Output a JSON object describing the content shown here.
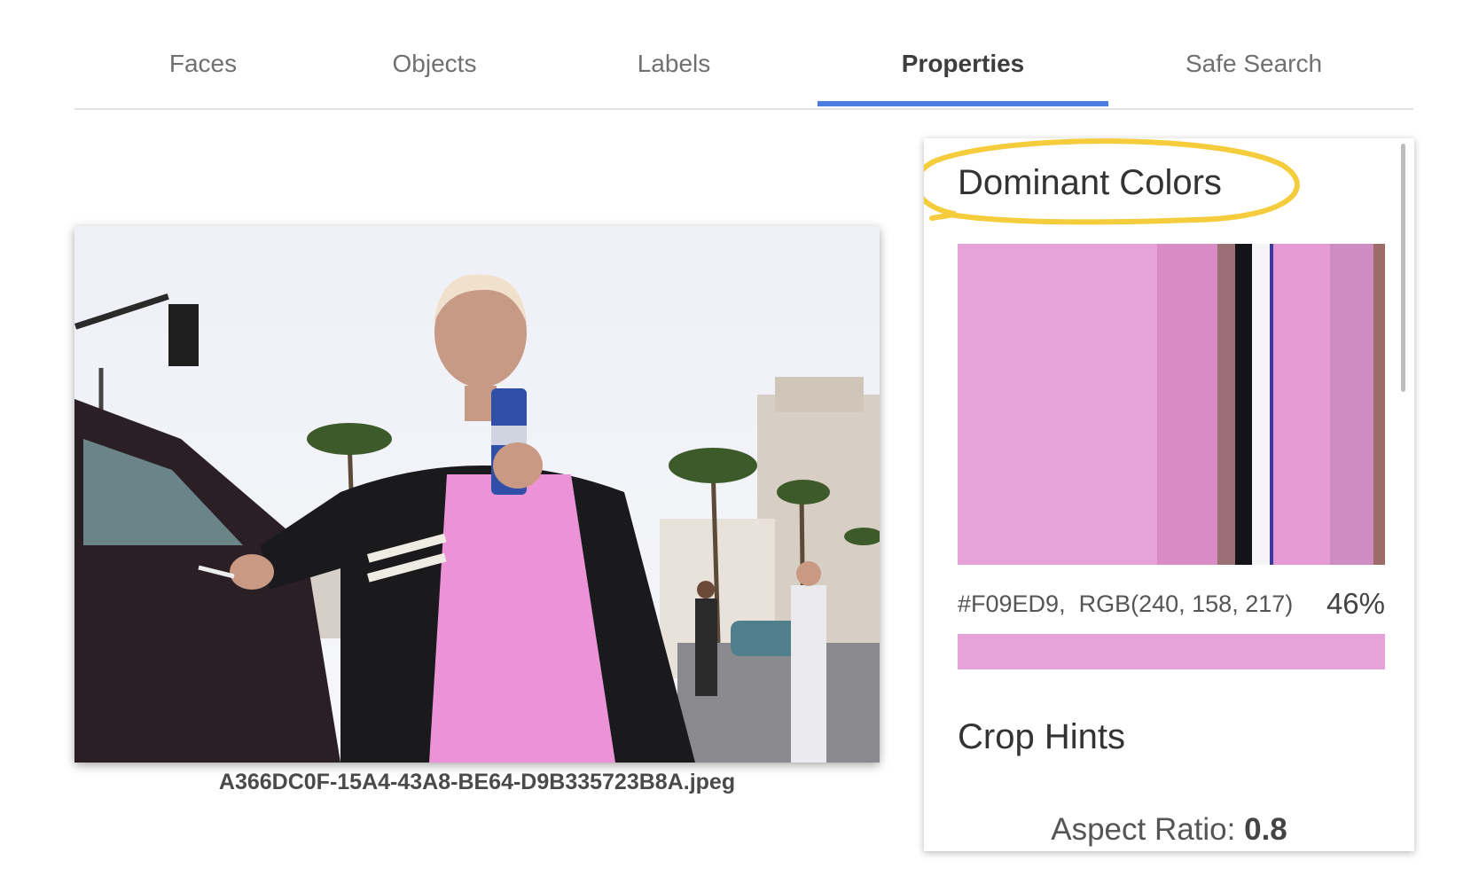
{
  "tabs": [
    {
      "label": "Faces"
    },
    {
      "label": "Objects"
    },
    {
      "label": "Labels"
    },
    {
      "label": "Properties"
    },
    {
      "label": "Safe Search"
    }
  ],
  "active_tab": "Properties",
  "image": {
    "filename": "A366DC0F-15A4-43A8-BE64-D9B335723B8A.jpeg"
  },
  "properties": {
    "dominant_colors_title": "Dominant Colors",
    "swatches": [
      {
        "color": "#e6a2d9",
        "share": 46
      },
      {
        "color": "#d98bc6",
        "share": 14
      },
      {
        "color": "#9c6e75",
        "share": 4
      },
      {
        "color": "#141418",
        "share": 4
      },
      {
        "color": "#f6f4f6",
        "share": 4
      },
      {
        "color": "#3a3aa0",
        "share": 0.3
      },
      {
        "color": "#e59ad6",
        "share": 13
      },
      {
        "color": "#cf8cc2",
        "share": 10
      },
      {
        "color": "#9e6c68",
        "share": 2.7
      }
    ],
    "selected_color": {
      "hex": "#F09ED9,",
      "rgb": "RGB(240, 158, 217)",
      "percent": "46%",
      "swatch_color": "#e6a2d9"
    },
    "crop_hints_title": "Crop Hints",
    "aspect_label": "Aspect Ratio:",
    "aspect_value": "0.8"
  },
  "colors": {
    "accent": "#4a7ddf",
    "highlight_circle": "#f5cc3b"
  }
}
